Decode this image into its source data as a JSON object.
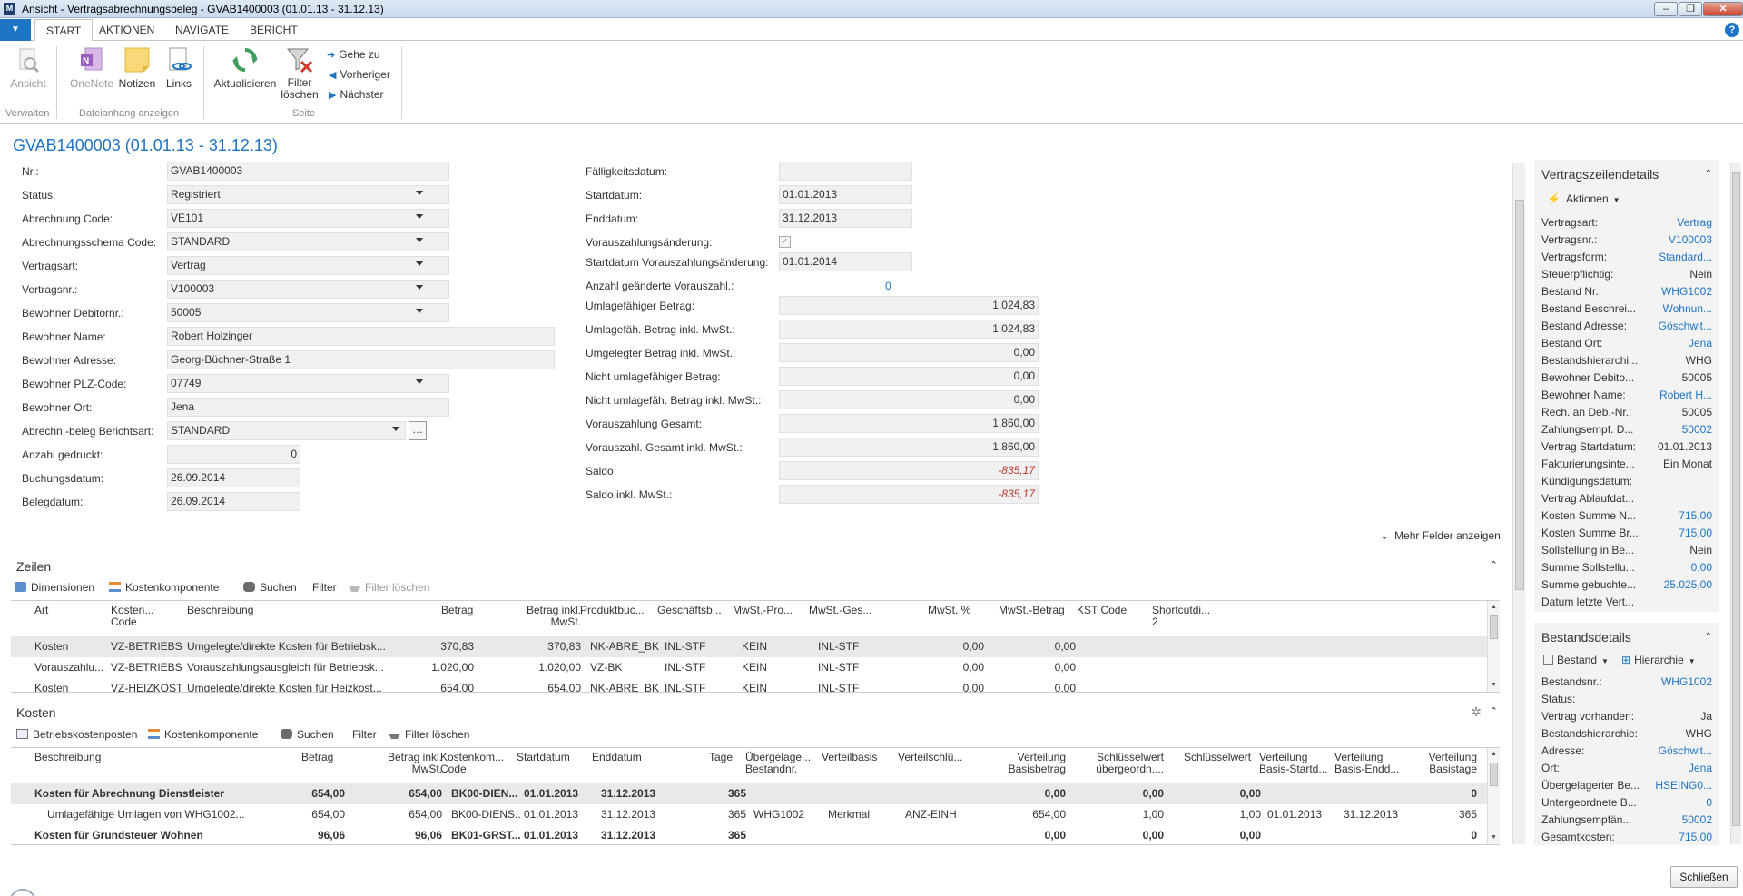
{
  "window": {
    "title": "Ansicht - Vertragsabrechnungsbeleg - GVAB1400003 (01.01.13 - 31.12.13)",
    "minimize": "–",
    "restore": "❐",
    "close": "✕"
  },
  "ribbon": {
    "tabs": [
      "START",
      "AKTIONEN",
      "NAVIGATE",
      "BERICHT"
    ],
    "help": "?",
    "buttons": {
      "ansicht": "Ansicht",
      "onenote": "OneNote",
      "notizen": "Notizen",
      "links": "Links",
      "aktualisieren": "Aktualisieren",
      "filter_loeschen_1": "Filter",
      "filter_loeschen_2": "löschen",
      "gehe_zu": "Gehe zu",
      "vorheriger": "Vorheriger",
      "naechster": "Nächster"
    },
    "groups": {
      "verwalten": "Verwalten",
      "dateianhang": "Dateianhang anzeigen",
      "seite": "Seite"
    }
  },
  "page_title": "GVAB1400003 (01.01.13 - 31.12.13)",
  "general_left": {
    "nr": {
      "label": "Nr.:",
      "value": "GVAB1400003"
    },
    "status": {
      "label": "Status:",
      "value": "Registriert"
    },
    "abrechnung_code": {
      "label": "Abrechnung Code:",
      "value": "VE101"
    },
    "schema": {
      "label": "Abrechnungsschema Code:",
      "value": "STANDARD"
    },
    "vertragsart": {
      "label": "Vertragsart:",
      "value": "Vertrag"
    },
    "vertragsnr": {
      "label": "Vertragsnr.:",
      "value": "V100003"
    },
    "debitornr": {
      "label": "Bewohner Debitornr.:",
      "value": "50005"
    },
    "name": {
      "label": "Bewohner Name:",
      "value": "Robert Holzinger"
    },
    "adresse": {
      "label": "Bewohner Adresse:",
      "value": "Georg-Büchner-Straße 1"
    },
    "plz": {
      "label": "Bewohner PLZ-Code:",
      "value": "07749"
    },
    "ort": {
      "label": "Bewohner Ort:",
      "value": "Jena"
    },
    "berichtsart": {
      "label": "Abrechn.-beleg Berichtsart:",
      "value": "STANDARD"
    },
    "gedruckt": {
      "label": "Anzahl gedruckt:",
      "value": "0"
    },
    "buchungsdatum": {
      "label": "Buchungsdatum:",
      "value": "26.09.2014"
    },
    "belegdatum": {
      "label": "Belegdatum:",
      "value": "26.09.2014"
    }
  },
  "general_right": {
    "faelligkeit": {
      "label": "Fälligkeitsdatum:",
      "value": ""
    },
    "startdatum": {
      "label": "Startdatum:",
      "value": "01.01.2013"
    },
    "enddatum": {
      "label": "Enddatum:",
      "value": "31.12.2013"
    },
    "vzaenderung": {
      "label": "Vorauszahlungsänderung:",
      "checked": true
    },
    "start_vz": {
      "label": "Startdatum Vorauszahlungsänderung:",
      "value": "01.01.2014"
    },
    "anzahl_vz": {
      "label": "Anzahl geänderte Vorauszahl.:",
      "value": "0"
    },
    "umlagefaehig": {
      "label": "Umlagefähiger Betrag:",
      "value": "1.024,83"
    },
    "umlagefaehig_mwst": {
      "label": "Umlagefäh. Betrag inkl. MwSt.:",
      "value": "1.024,83"
    },
    "umgelegt_mwst": {
      "label": "Umgelegter Betrag inkl. MwSt.:",
      "value": "0,00"
    },
    "nicht_umlagefaehig": {
      "label": "Nicht umlagefähiger Betrag:",
      "value": "0,00"
    },
    "nicht_umlagefaehig_mwst": {
      "label": "Nicht umlagefäh. Betrag inkl. MwSt.:",
      "value": "0,00"
    },
    "vz_gesamt": {
      "label": "Vorauszahlung Gesamt:",
      "value": "1.860,00"
    },
    "vz_gesamt_mwst": {
      "label": "Vorauszahl. Gesamt inkl. MwSt.:",
      "value": "1.860,00"
    },
    "saldo": {
      "label": "Saldo:",
      "value": "-835,17"
    },
    "saldo_mwst": {
      "label": "Saldo inkl. MwSt.:",
      "value": "-835,17"
    }
  },
  "more_fields": "Mehr Felder anzeigen",
  "zeilen": {
    "title": "Zeilen",
    "toolbar": [
      "Dimensionen",
      "Kostenkomponente",
      "Suchen",
      "Filter",
      "Filter löschen"
    ],
    "columns": [
      "Art",
      "Kosten... Code",
      "Beschreibung",
      "Betrag",
      "Betrag inkl. MwSt.",
      "Produktbuc...",
      "Geschäftsb...",
      "MwSt.-Pro...",
      "MwSt.-Ges...",
      "MwSt. %",
      "MwSt.-Betrag",
      "KST Code",
      "Shortcutdi... 2"
    ],
    "rows": [
      [
        "Kosten",
        "VZ-BETRIEBS",
        "Umgelegte/direkte Kosten für Betriebsk...",
        "370,83",
        "370,83",
        "NK-ABRE_BK",
        "INL-STF",
        "KEIN",
        "INL-STF",
        "0,00",
        "0,00"
      ],
      [
        "Vorauszahlu...",
        "VZ-BETRIEBS",
        "Vorauszahlungsausgleich für Betriebsk...",
        "1.020,00",
        "1.020,00",
        "VZ-BK",
        "INL-STF",
        "KEIN",
        "INL-STF",
        "0,00",
        "0,00"
      ],
      [
        "Kosten",
        "VZ-HEIZKOST",
        "Umgelegte/direkte Kosten für Heizkost...",
        "654,00",
        "654,00",
        "NK-ABRE_BK",
        "INL-STF",
        "KEIN",
        "INL-STF",
        "0,00",
        "0,00"
      ]
    ]
  },
  "kosten": {
    "title": "Kosten",
    "toolbar": [
      "Betriebskostenposten",
      "Kostenkomponente",
      "Suchen",
      "Filter",
      "Filter löschen"
    ],
    "columns": [
      "Beschreibung",
      "Betrag",
      "Betrag inkl. MwSt.",
      "Kostenkom... Code",
      "Startdatum",
      "Enddatum",
      "Tage",
      "Übergelage... Bestandnr.",
      "Verteilbasis",
      "Verteilschlü...",
      "Verteilung Basisbetrag",
      "Schlüsselwert übergeordn....",
      "Schlüsselwert",
      "Verteilung Basis-Startd...",
      "Verteilung Basis-Endd...",
      "Verteilung Basistage"
    ],
    "rows": [
      [
        "Kosten für Abrechnung Dienstleister",
        "654,00",
        "654,00",
        "BK00-DIEN...",
        "01.01.2013",
        "31.12.2013",
        "365",
        "",
        "",
        "",
        "0,00",
        "0,00",
        "0,00",
        "",
        "",
        "0"
      ],
      [
        "Umlagefähige Umlagen von WHG1002...",
        "654,00",
        "654,00",
        "BK00-DIENS...",
        "01.01.2013",
        "31.12.2013",
        "365",
        "WHG1002",
        "Merkmal",
        "ANZ-EINH",
        "654,00",
        "1,00",
        "1,00",
        "01.01.2013",
        "31.12.2013",
        "365"
      ],
      [
        "Kosten für Grundsteuer Wohnen",
        "96,06",
        "96,06",
        "BK01-GRST...",
        "01.01.2013",
        "31.12.2013",
        "365",
        "",
        "",
        "",
        "0,00",
        "0,00",
        "0,00",
        "",
        "",
        "0"
      ]
    ]
  },
  "factbox_vertrag": {
    "title": "Vertragszeilendetails",
    "action": "Aktionen",
    "rows": [
      [
        "Vertragsart:",
        "Vertrag"
      ],
      [
        "Vertragsnr.:",
        "V100003"
      ],
      [
        "Vertragsform:",
        "Standard..."
      ],
      [
        "Steuerpflichtig:",
        "Nein"
      ],
      [
        "Bestand Nr.:",
        "WHG1002"
      ],
      [
        "Bestand Beschrei...",
        "Wohnun..."
      ],
      [
        "Bestand Adresse:",
        "Göschwit..."
      ],
      [
        "Bestand Ort:",
        "Jena"
      ],
      [
        "Bestandshierarchi...",
        "WHG"
      ],
      [
        "Bewohner Debito...",
        "50005"
      ],
      [
        "Bewohner Name:",
        "Robert H..."
      ],
      [
        "Rech. an Deb.-Nr.:",
        "50005"
      ],
      [
        "Zahlungsempf. D...",
        "50002"
      ],
      [
        "Vertrag Startdatum:",
        "01.01.2013"
      ],
      [
        "Fakturierungsinte...",
        "Ein Monat"
      ],
      [
        "Kündigungsdatum:",
        ""
      ],
      [
        "Vertrag Ablaufdat...",
        ""
      ],
      [
        "Kosten Summe N...",
        "715,00"
      ],
      [
        "Kosten Summe Br...",
        "715,00"
      ],
      [
        "Sollstellung in Be...",
        "Nein"
      ],
      [
        "Summe Sollstellu...",
        "0,00"
      ],
      [
        "Summe gebuchte...",
        "25.025,00"
      ],
      [
        "Datum letzte Vert...",
        ""
      ]
    ]
  },
  "factbox_bestand": {
    "title": "Bestandsdetails",
    "action1": "Bestand",
    "action2": "Hierarchie",
    "rows": [
      [
        "Bestandsnr.:",
        "WHG1002"
      ],
      [
        "Status:",
        ""
      ],
      [
        "Vertrag vorhanden:",
        "Ja"
      ],
      [
        "Bestandshierarchie:",
        "WHG"
      ],
      [
        "Adresse:",
        "Göschwit..."
      ],
      [
        "Ort:",
        "Jena"
      ],
      [
        "Übergelagerter Be...",
        "HSEING0..."
      ],
      [
        "Untergeordnete B...",
        "0"
      ],
      [
        "Zahlungsempfän...",
        "50002"
      ],
      [
        "Gesamtkosten:",
        "715,00"
      ]
    ]
  },
  "footer": {
    "close": "Schließen"
  }
}
